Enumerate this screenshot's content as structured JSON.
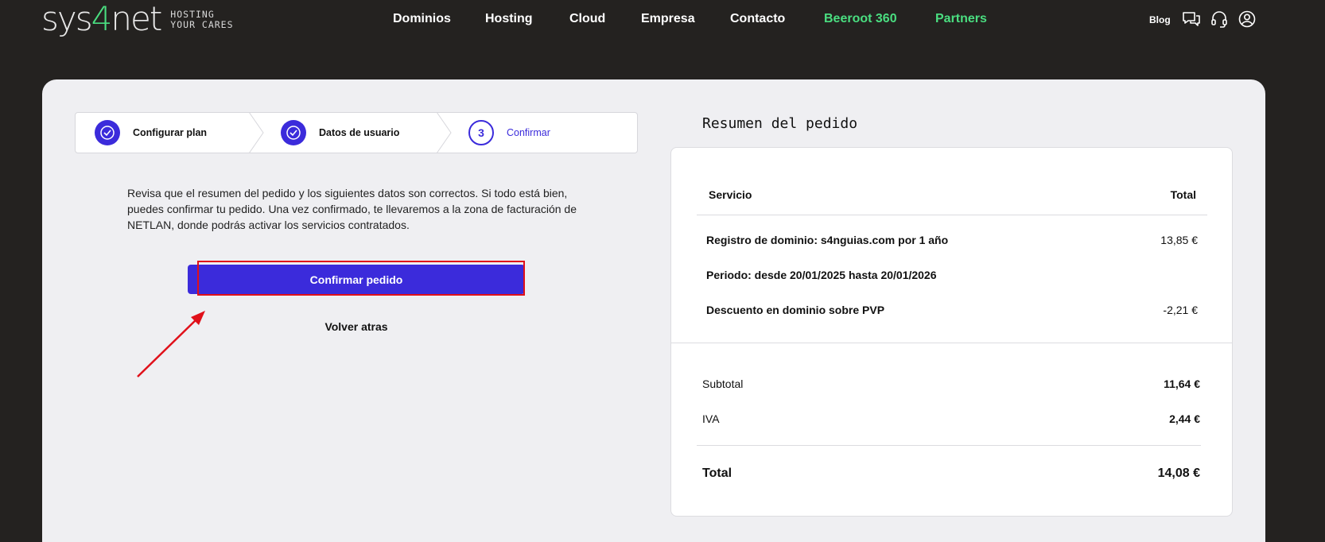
{
  "header": {
    "logo_prefix": "sys",
    "logo_four": "4",
    "logo_suffix": "net",
    "tagline_1": "HOSTING",
    "tagline_2": "YOUR CARES",
    "nav": [
      {
        "label": "Dominios"
      },
      {
        "label": "Hosting"
      },
      {
        "label": "Cloud"
      },
      {
        "label": "Empresa"
      },
      {
        "label": "Contacto"
      },
      {
        "label": "Beeroot 360"
      },
      {
        "label": "Partners"
      }
    ],
    "blog_label": "Blog",
    "icons": [
      "chat-icon",
      "headset-icon",
      "user-icon"
    ]
  },
  "stepper": {
    "steps": [
      {
        "label": "Configurar plan",
        "state": "done"
      },
      {
        "label": "Datos de usuario",
        "state": "done"
      },
      {
        "number": "3",
        "label": "Confirmar",
        "state": "current"
      }
    ]
  },
  "main": {
    "description": "Revisa que el resumen del pedido y los siguientes datos son correctos. Si todo está bien, puedes confirmar tu pedido. Una vez confirmado, te llevaremos a la zona de facturación de NETLAN, donde podrás activar los servicios contratados.",
    "confirm_label": "Confirmar pedido",
    "back_label": "Volver atras"
  },
  "summary": {
    "title": "Resumen del pedido",
    "col_service": "Servicio",
    "col_total": "Total",
    "items": [
      {
        "label": "Registro de dominio: s4nguias.com por 1 año",
        "amount": "13,85 €"
      },
      {
        "label": "Periodo: desde 20/01/2025 hasta 20/01/2026",
        "amount": ""
      },
      {
        "label": "Descuento en dominio sobre PVP",
        "amount": "-2,21 €"
      }
    ],
    "subtotal_label": "Subtotal",
    "subtotal_value": "11,64 €",
    "iva_label": "IVA",
    "iva_value": "2,44 €",
    "total_label": "Total",
    "total_value": "14,08 €"
  },
  "colors": {
    "accent": "#3b2bdb",
    "green": "#4ade80",
    "background": "#242220",
    "highlight": "#e0101a"
  }
}
